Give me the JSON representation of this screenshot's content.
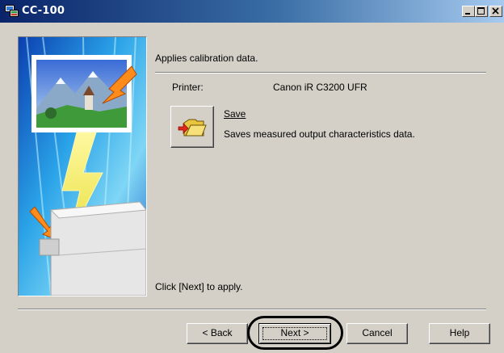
{
  "window": {
    "title": "CC-100",
    "icon": "app-icon",
    "controls": [
      "minimize-icon",
      "maximize-icon",
      "close-icon"
    ]
  },
  "header": {
    "text": "Applies calibration data."
  },
  "printer": {
    "label": "Printer:",
    "value": "Canon iR C3200 UFR"
  },
  "save": {
    "title": "Save",
    "description": "Saves measured output characteristics data.",
    "icon": "folder-save-icon"
  },
  "footer": {
    "instruction": "Click [Next] to apply."
  },
  "buttons": {
    "back": "< Back",
    "next": "Next >",
    "cancel": "Cancel",
    "help": "Help"
  },
  "colors": {
    "titlebar_start": "#0a246a",
    "titlebar_end": "#a6caf0",
    "dialog_bg": "#d4d0c8"
  }
}
